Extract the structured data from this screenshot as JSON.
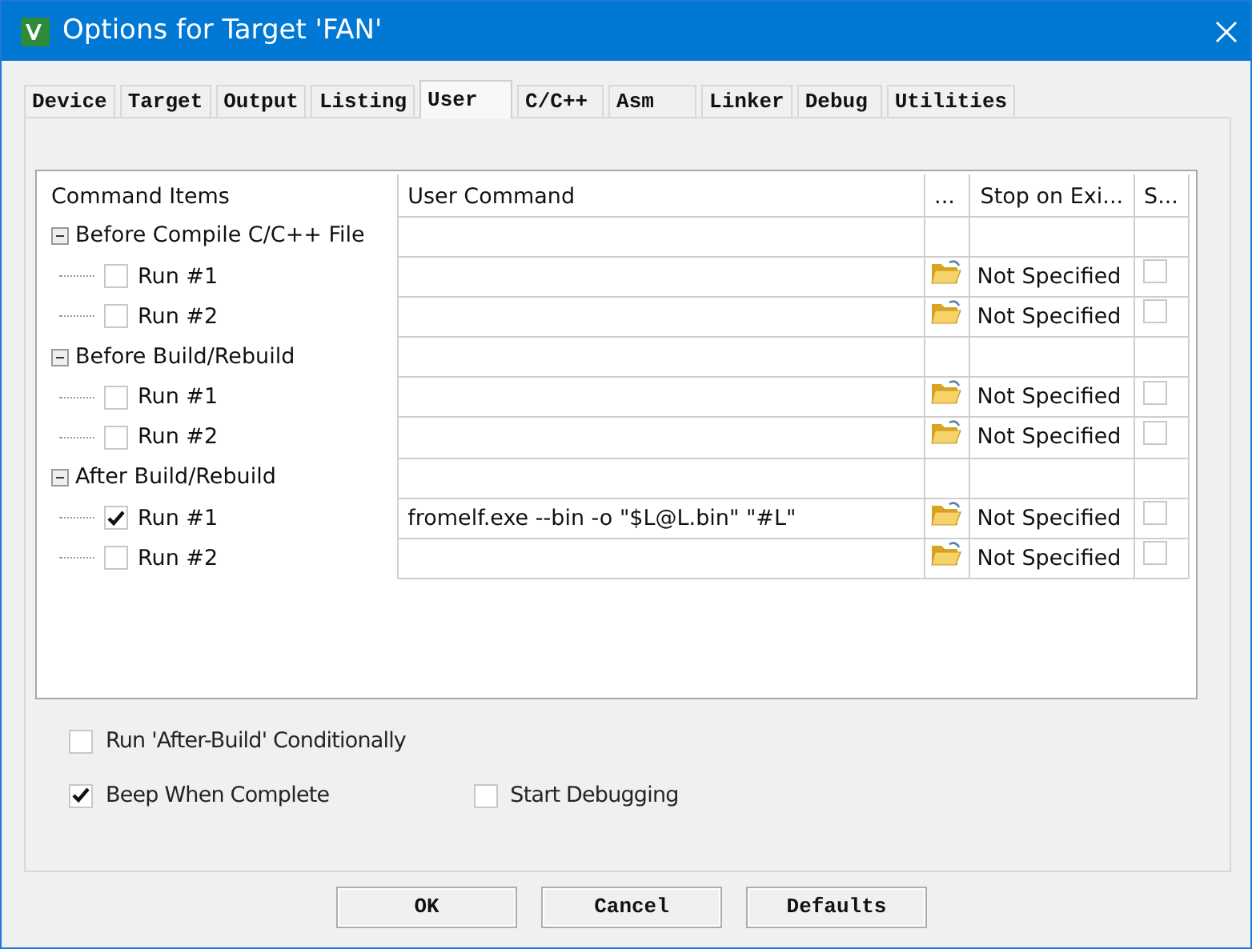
{
  "window": {
    "title": "Options for Target 'FAN'"
  },
  "tabs": [
    {
      "label": "Device",
      "selected": false
    },
    {
      "label": "Target",
      "selected": false
    },
    {
      "label": "Output",
      "selected": false
    },
    {
      "label": "Listing",
      "selected": false
    },
    {
      "label": "User",
      "selected": true
    },
    {
      "label": "C/C++",
      "selected": false
    },
    {
      "label": "Asm",
      "selected": false
    },
    {
      "label": "Linker",
      "selected": false
    },
    {
      "label": "Debug",
      "selected": false
    },
    {
      "label": "Utilities",
      "selected": false
    }
  ],
  "grid": {
    "columns": [
      "Command Items",
      "User Command",
      "...",
      "Stop on Exi...",
      "S..."
    ],
    "groups": [
      {
        "label": "Before Compile C/C++ File",
        "expanded": true,
        "items": [
          {
            "label": "Run #1",
            "checked": false,
            "stop_on_exit": "Not Specified",
            "column_5_checked": false
          },
          {
            "label": "Run #2",
            "checked": false,
            "stop_on_exit": "Not Specified",
            "column_5_checked": false
          }
        ]
      },
      {
        "label": "Before Build/Rebuild",
        "expanded": true,
        "items": [
          {
            "label": "Run #1",
            "checked": false,
            "stop_on_exit": "Not Specified",
            "column_5_checked": false
          },
          {
            "label": "Run #2",
            "checked": false,
            "stop_on_exit": "Not Specified",
            "column_5_checked": false
          }
        ]
      },
      {
        "label": "After Build/Rebuild",
        "expanded": true,
        "items": [
          {
            "label": "Run #1",
            "checked": true,
            "command": "fromelf.exe --bin -o \"$L@L.bin\" \"#L\"",
            "stop_on_exit": "Not Specified",
            "column_5_checked": false
          },
          {
            "label": "Run #2",
            "checked": false,
            "stop_on_exit": "Not Specified",
            "column_5_checked": false
          }
        ]
      }
    ]
  },
  "options": [
    {
      "label": "Run 'After-Build' Conditionally",
      "checked": false
    },
    {
      "label": "Beep When Complete",
      "checked": true
    },
    {
      "label": "Start Debugging",
      "checked": false
    }
  ],
  "buttons": [
    "OK",
    "Cancel",
    "Defaults"
  ]
}
